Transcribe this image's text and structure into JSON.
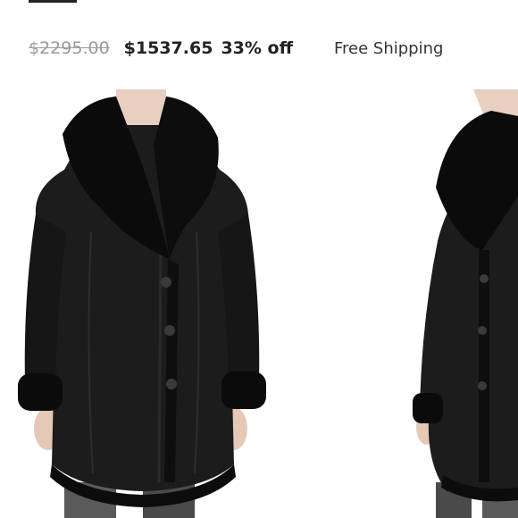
{
  "pricing": {
    "original_price": "$2295.00",
    "current_price": "$1537.65",
    "discount": "33% off",
    "shipping": "Free Shipping"
  },
  "gallery": {
    "images": [
      {
        "icon": "product-photo-coat-front"
      },
      {
        "icon": "product-photo-coat-angle"
      }
    ]
  },
  "colors": {
    "strike_price": "#9a9a9a",
    "price": "#222222",
    "coat": "#1a1a1a"
  }
}
